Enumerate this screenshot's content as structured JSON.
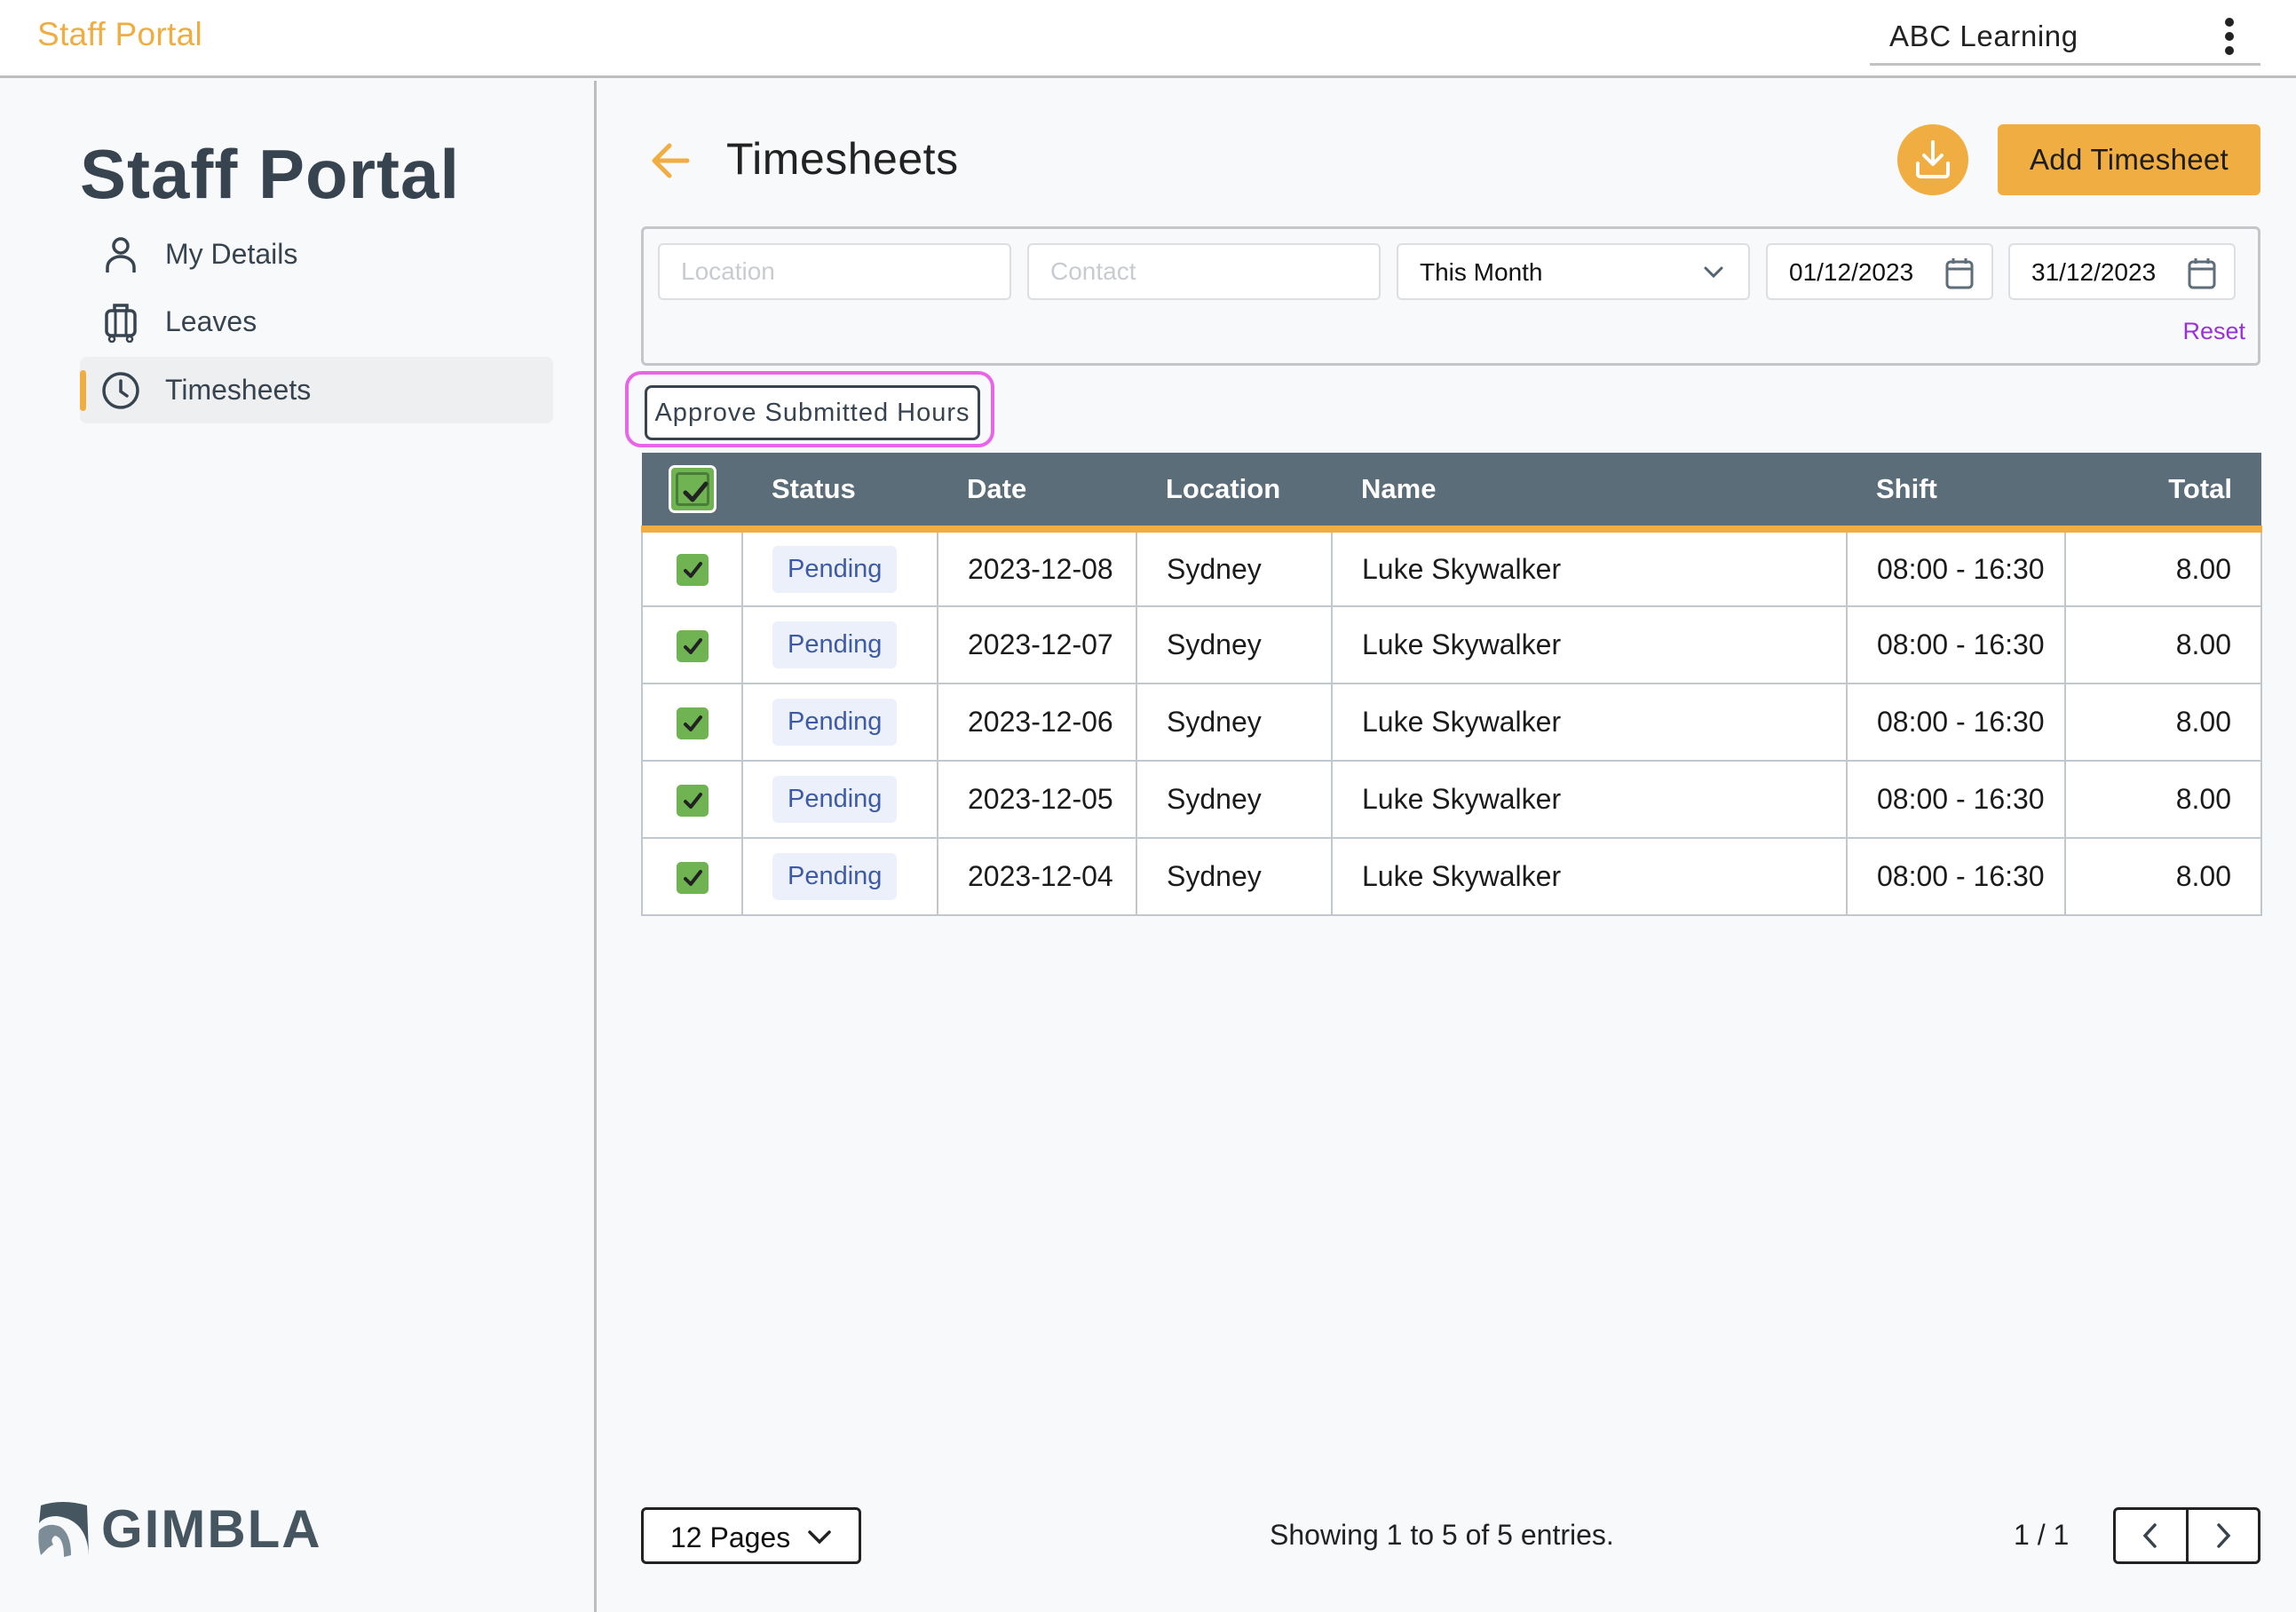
{
  "topbar": {
    "brand": "Staff Portal",
    "org_name": "ABC Learning",
    "menu_icon": "more-vertical-icon"
  },
  "sidebar": {
    "title": "Staff Portal",
    "items": [
      {
        "label": "My Details",
        "icon": "person-icon",
        "active": false
      },
      {
        "label": "Leaves",
        "icon": "luggage-icon",
        "active": false
      },
      {
        "label": "Timesheets",
        "icon": "clock-icon",
        "active": true
      }
    ],
    "logo_text": "GIMBLA"
  },
  "header": {
    "title": "Timesheets",
    "back_icon": "arrow-left-icon",
    "download_icon": "download-icon",
    "add_label": "Add Timesheet"
  },
  "filters": {
    "location_placeholder": "Location",
    "location_value": "",
    "contact_placeholder": "Contact",
    "contact_value": "",
    "period": "This Month",
    "date_from": "01/12/2023",
    "date_to": "31/12/2023",
    "reset_label": "Reset"
  },
  "actions": {
    "approve_label": "Approve Submitted Hours"
  },
  "table": {
    "columns": [
      "Status",
      "Date",
      "Location",
      "Name",
      "Shift",
      "Total"
    ],
    "select_all_checked": true,
    "rows": [
      {
        "checked": true,
        "status": "Pending",
        "date": "2023-12-08",
        "location": "Sydney",
        "name": "Luke Skywalker",
        "shift": "08:00 - 16:30",
        "total": "8.00"
      },
      {
        "checked": true,
        "status": "Pending",
        "date": "2023-12-07",
        "location": "Sydney",
        "name": "Luke Skywalker",
        "shift": "08:00 - 16:30",
        "total": "8.00"
      },
      {
        "checked": true,
        "status": "Pending",
        "date": "2023-12-06",
        "location": "Sydney",
        "name": "Luke Skywalker",
        "shift": "08:00 - 16:30",
        "total": "8.00"
      },
      {
        "checked": true,
        "status": "Pending",
        "date": "2023-12-05",
        "location": "Sydney",
        "name": "Luke Skywalker",
        "shift": "08:00 - 16:30",
        "total": "8.00"
      },
      {
        "checked": true,
        "status": "Pending",
        "date": "2023-12-04",
        "location": "Sydney",
        "name": "Luke Skywalker",
        "shift": "08:00 - 16:30",
        "total": "8.00"
      }
    ]
  },
  "footer": {
    "per_page": "12 Pages",
    "showing": "Showing 1 to 5 of 5 entries.",
    "page_of": "1 / 1"
  },
  "colors": {
    "accent": "#f0ad42",
    "header_bg": "#5b6d79",
    "checkbox_green": "#6fb353",
    "reset_purple": "#9b30d9",
    "highlight_magenta": "#e865e8",
    "badge_bg": "#ecf0fb",
    "badge_text": "#3d5aa5"
  }
}
